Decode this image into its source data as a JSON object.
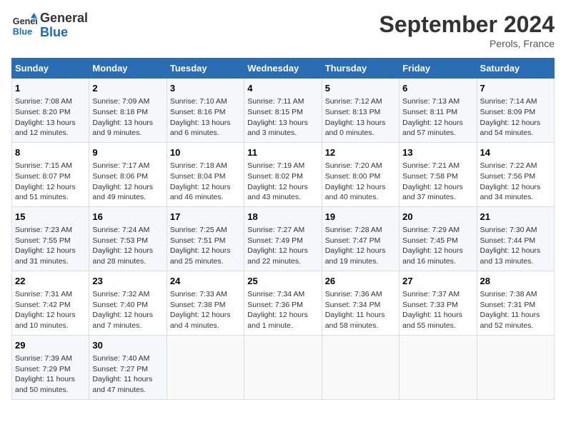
{
  "logo": {
    "line1": "General",
    "line2": "Blue"
  },
  "title": "September 2024",
  "location": "Perols, France",
  "days_of_week": [
    "Sunday",
    "Monday",
    "Tuesday",
    "Wednesday",
    "Thursday",
    "Friday",
    "Saturday"
  ],
  "weeks": [
    [
      {
        "num": "1",
        "info": "Sunrise: 7:08 AM\nSunset: 8:20 PM\nDaylight: 13 hours and 12 minutes."
      },
      {
        "num": "2",
        "info": "Sunrise: 7:09 AM\nSunset: 8:18 PM\nDaylight: 13 hours and 9 minutes."
      },
      {
        "num": "3",
        "info": "Sunrise: 7:10 AM\nSunset: 8:16 PM\nDaylight: 13 hours and 6 minutes."
      },
      {
        "num": "4",
        "info": "Sunrise: 7:11 AM\nSunset: 8:15 PM\nDaylight: 13 hours and 3 minutes."
      },
      {
        "num": "5",
        "info": "Sunrise: 7:12 AM\nSunset: 8:13 PM\nDaylight: 13 hours and 0 minutes."
      },
      {
        "num": "6",
        "info": "Sunrise: 7:13 AM\nSunset: 8:11 PM\nDaylight: 12 hours and 57 minutes."
      },
      {
        "num": "7",
        "info": "Sunrise: 7:14 AM\nSunset: 8:09 PM\nDaylight: 12 hours and 54 minutes."
      }
    ],
    [
      {
        "num": "8",
        "info": "Sunrise: 7:15 AM\nSunset: 8:07 PM\nDaylight: 12 hours and 51 minutes."
      },
      {
        "num": "9",
        "info": "Sunrise: 7:17 AM\nSunset: 8:06 PM\nDaylight: 12 hours and 49 minutes."
      },
      {
        "num": "10",
        "info": "Sunrise: 7:18 AM\nSunset: 8:04 PM\nDaylight: 12 hours and 46 minutes."
      },
      {
        "num": "11",
        "info": "Sunrise: 7:19 AM\nSunset: 8:02 PM\nDaylight: 12 hours and 43 minutes."
      },
      {
        "num": "12",
        "info": "Sunrise: 7:20 AM\nSunset: 8:00 PM\nDaylight: 12 hours and 40 minutes."
      },
      {
        "num": "13",
        "info": "Sunrise: 7:21 AM\nSunset: 7:58 PM\nDaylight: 12 hours and 37 minutes."
      },
      {
        "num": "14",
        "info": "Sunrise: 7:22 AM\nSunset: 7:56 PM\nDaylight: 12 hours and 34 minutes."
      }
    ],
    [
      {
        "num": "15",
        "info": "Sunrise: 7:23 AM\nSunset: 7:55 PM\nDaylight: 12 hours and 31 minutes."
      },
      {
        "num": "16",
        "info": "Sunrise: 7:24 AM\nSunset: 7:53 PM\nDaylight: 12 hours and 28 minutes."
      },
      {
        "num": "17",
        "info": "Sunrise: 7:25 AM\nSunset: 7:51 PM\nDaylight: 12 hours and 25 minutes."
      },
      {
        "num": "18",
        "info": "Sunrise: 7:27 AM\nSunset: 7:49 PM\nDaylight: 12 hours and 22 minutes."
      },
      {
        "num": "19",
        "info": "Sunrise: 7:28 AM\nSunset: 7:47 PM\nDaylight: 12 hours and 19 minutes."
      },
      {
        "num": "20",
        "info": "Sunrise: 7:29 AM\nSunset: 7:45 PM\nDaylight: 12 hours and 16 minutes."
      },
      {
        "num": "21",
        "info": "Sunrise: 7:30 AM\nSunset: 7:44 PM\nDaylight: 12 hours and 13 minutes."
      }
    ],
    [
      {
        "num": "22",
        "info": "Sunrise: 7:31 AM\nSunset: 7:42 PM\nDaylight: 12 hours and 10 minutes."
      },
      {
        "num": "23",
        "info": "Sunrise: 7:32 AM\nSunset: 7:40 PM\nDaylight: 12 hours and 7 minutes."
      },
      {
        "num": "24",
        "info": "Sunrise: 7:33 AM\nSunset: 7:38 PM\nDaylight: 12 hours and 4 minutes."
      },
      {
        "num": "25",
        "info": "Sunrise: 7:34 AM\nSunset: 7:36 PM\nDaylight: 12 hours and 1 minute."
      },
      {
        "num": "26",
        "info": "Sunrise: 7:36 AM\nSunset: 7:34 PM\nDaylight: 11 hours and 58 minutes."
      },
      {
        "num": "27",
        "info": "Sunrise: 7:37 AM\nSunset: 7:33 PM\nDaylight: 11 hours and 55 minutes."
      },
      {
        "num": "28",
        "info": "Sunrise: 7:38 AM\nSunset: 7:31 PM\nDaylight: 11 hours and 52 minutes."
      }
    ],
    [
      {
        "num": "29",
        "info": "Sunrise: 7:39 AM\nSunset: 7:29 PM\nDaylight: 11 hours and 50 minutes."
      },
      {
        "num": "30",
        "info": "Sunrise: 7:40 AM\nSunset: 7:27 PM\nDaylight: 11 hours and 47 minutes."
      },
      null,
      null,
      null,
      null,
      null
    ]
  ]
}
